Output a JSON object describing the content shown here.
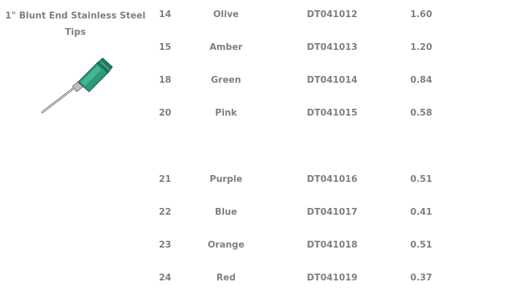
{
  "product": {
    "title_line1": "1\" Blunt End Stainless Steel",
    "title_line2": "Tips",
    "image_icon": "needle-tip-icon",
    "hub_color": "#2a9a7a"
  },
  "rows": [
    {
      "gauge": "14",
      "color": "Olive",
      "part": "DT041012",
      "id": "1.60"
    },
    {
      "gauge": "15",
      "color": "Amber",
      "part": "DT041013",
      "id": "1.20"
    },
    {
      "gauge": "18",
      "color": "Green",
      "part": "DT041014",
      "id": "0.84"
    },
    {
      "gauge": "20",
      "color": "Pink",
      "part": "DT041015",
      "id": "0.58"
    },
    {
      "gauge": "21",
      "color": "Purple",
      "part": "DT041016",
      "id": "0.51"
    },
    {
      "gauge": "22",
      "color": "Blue",
      "part": "DT041017",
      "id": "0.41"
    },
    {
      "gauge": "23",
      "color": "Orange",
      "part": "DT041018",
      "id": "0.51"
    },
    {
      "gauge": "24",
      "color": "Red",
      "part": "DT041019",
      "id": "0.37"
    }
  ]
}
